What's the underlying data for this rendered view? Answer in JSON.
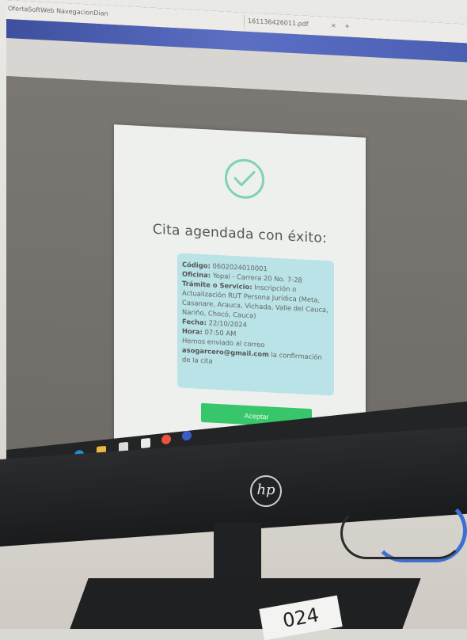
{
  "browser": {
    "tab1": "OfertaSoftWeb NavegacionDian",
    "tab2": "161136426011.pdf",
    "tab2_close": "×",
    "new_tab": "+"
  },
  "dialog": {
    "title": "Cita agendada con éxito:",
    "codigo_label": "Código:",
    "codigo_value": " 0602024010001",
    "oficina_label": "Oficina:",
    "oficina_value": " Yopal - Carrera 20 No. 7-28",
    "tramite_label": "Trámite o Servicio:",
    "tramite_value": " Inscripción o Actualización RUT Persona Jurídica (Meta, Casanare, Arauca, Vichada, Valle del Cauca, Nariño, Chocó, Cauca)",
    "fecha_label": "Fecha:",
    "fecha_value": " 22/10/2024",
    "hora_label": "Hora:",
    "hora_value": " 07:50 AM",
    "email_intro": "Hemos enviado al correo ",
    "email": "asogarcero@gmail.com",
    "email_outro": " la confirmación de la cita",
    "accept_button": "Aceptar",
    "success_color": "#7ed3b4",
    "button_color": "#37c66a",
    "info_bg": "#b9e3e6"
  },
  "taskbar": {
    "icons": [
      "search-icon",
      "task-view-icon",
      "edge-icon",
      "file-explorer-icon",
      "store-icon",
      "mail-icon",
      "chrome-icon",
      "app-icon"
    ]
  },
  "monitor": {
    "brand": "hp"
  },
  "sticker": {
    "text": "024"
  }
}
